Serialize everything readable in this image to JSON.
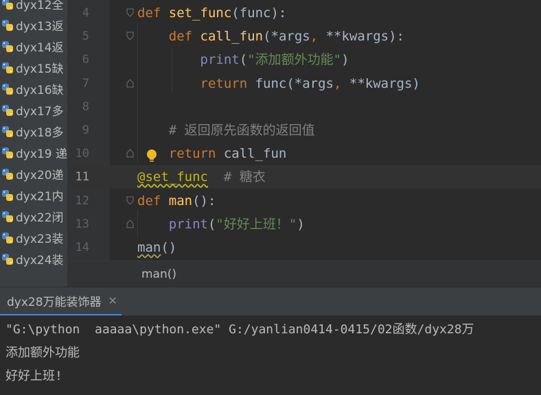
{
  "project_tree": {
    "items": [
      {
        "label": "dyx12全"
      },
      {
        "label": "dyx13返"
      },
      {
        "label": "dyx14返"
      },
      {
        "label": "dyx15缺"
      },
      {
        "label": "dyx16缺"
      },
      {
        "label": "dyx17多"
      },
      {
        "label": "dyx18多"
      },
      {
        "label": "dyx19 递"
      },
      {
        "label": "dyx20递"
      },
      {
        "label": "dyx21内"
      },
      {
        "label": "dyx22闭"
      },
      {
        "label": "dyx23装"
      },
      {
        "label": "dyx24装"
      }
    ]
  },
  "editor": {
    "current_line": "11",
    "lines": [
      {
        "n": "4",
        "t": [
          [
            "def",
            "kw"
          ],
          [
            " ",
            ""
          ],
          [
            "set_func",
            "fn"
          ],
          [
            "(func):",
            ""
          ]
        ]
      },
      {
        "n": "5",
        "t": [
          [
            "    ",
            ""
          ],
          [
            "def",
            "kw"
          ],
          [
            " ",
            ""
          ],
          [
            "call_fun",
            "fn"
          ],
          [
            "(*args",
            ""
          ],
          [
            ", ",
            "kw"
          ],
          [
            "**kwargs):",
            ""
          ]
        ]
      },
      {
        "n": "6",
        "t": [
          [
            "        ",
            ""
          ],
          [
            "print",
            "builtin"
          ],
          [
            "(",
            ""
          ],
          [
            "\"添加额外功能\"",
            "str"
          ],
          [
            ")",
            ""
          ]
        ]
      },
      {
        "n": "7",
        "t": [
          [
            "        ",
            ""
          ],
          [
            "return",
            "kw"
          ],
          [
            " func(*args",
            ""
          ],
          [
            ", ",
            "kw"
          ],
          [
            "**kwargs)",
            ""
          ]
        ]
      },
      {
        "n": "8",
        "t": []
      },
      {
        "n": "9",
        "t": [
          [
            "    ",
            ""
          ],
          [
            "# 返回原先函数的返回值",
            "cmt"
          ]
        ]
      },
      {
        "n": "10",
        "t": [
          [
            "    ",
            ""
          ],
          [
            "return",
            "kw"
          ],
          [
            " call_fun",
            ""
          ]
        ]
      },
      {
        "n": "11",
        "t": [
          [
            "@set_func",
            "deco"
          ],
          [
            "  ",
            ""
          ],
          [
            "# 糖衣",
            "cmt"
          ]
        ]
      },
      {
        "n": "12",
        "t": [
          [
            "def",
            "kw"
          ],
          [
            " ",
            ""
          ],
          [
            "man",
            "fn"
          ],
          [
            "():",
            ""
          ]
        ]
      },
      {
        "n": "13",
        "t": [
          [
            "    ",
            ""
          ],
          [
            "print",
            "builtin"
          ],
          [
            "(",
            ""
          ],
          [
            "\"好好上班！\"",
            "str"
          ],
          [
            ")",
            ""
          ]
        ]
      },
      {
        "n": "14",
        "t": [
          [
            "man",
            "wavy"
          ],
          [
            "()",
            ""
          ]
        ]
      }
    ]
  },
  "breadcrumb": {
    "text": "man()"
  },
  "run": {
    "tab_label": "dyx28万能装饰器",
    "close_label": "✕",
    "output": [
      "\"G:\\python  aaaaa\\python.exe\" G:/yanlian0414-0415/02函数/dyx28万",
      "添加额外功能",
      "好好上班!"
    ]
  },
  "icons": {
    "tree_item": "python-file-icon",
    "bulb": "intention-bulb-icon",
    "fold": "fold-marker-icon"
  },
  "colors": {
    "keyword": "#cc7832",
    "function": "#ffc66d",
    "builtin": "#8888c6",
    "string": "#6a8759",
    "comment": "#808080",
    "decorator": "#bbb529",
    "text": "#a9b7c6"
  }
}
